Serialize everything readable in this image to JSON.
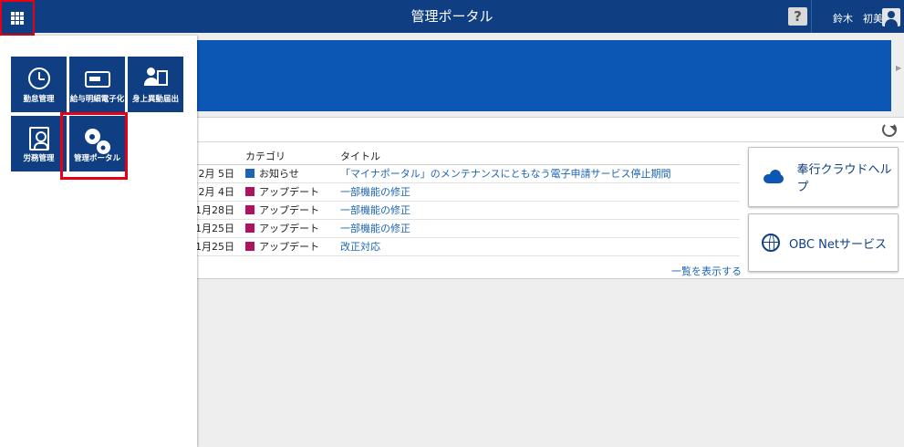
{
  "header": {
    "title": "管理ポータル",
    "help_label": "?",
    "user_name": "鈴木　初美"
  },
  "launcher": {
    "tiles": [
      {
        "label": "勤怠管理",
        "icon": "clock-icon"
      },
      {
        "label": "給与明細電子化",
        "icon": "payslip-card-icon"
      },
      {
        "label": "身上異動届出",
        "icon": "person-document-icon"
      },
      {
        "label": "労務管理",
        "icon": "person-file-icon"
      },
      {
        "label": "管理ポータル",
        "icon": "gears-icon",
        "selected": true
      }
    ]
  },
  "news": {
    "columns": {
      "date": "",
      "category": "カテゴリ",
      "title": "タイトル"
    },
    "rows": [
      {
        "date": "2月 5日",
        "category": "お知らせ",
        "category_color": "#1d64b4",
        "title": "「マイナポータル」のメンテナンスにともなう電子申請サービス停止期間"
      },
      {
        "date": "2月 4日",
        "category": "アップデート",
        "category_color": "#b0125f",
        "title": "一部機能の修正"
      },
      {
        "date": "1月28日",
        "category": "アップデート",
        "category_color": "#b0125f",
        "title": "一部機能の修正"
      },
      {
        "date": "1月25日",
        "category": "アップデート",
        "category_color": "#b0125f",
        "title": "一部機能の修正"
      },
      {
        "date": "1月25日",
        "category": "アップデート",
        "category_color": "#b0125f",
        "title": "改正対応"
      }
    ],
    "view_all": "一覧を表示する"
  },
  "side_buttons": {
    "help": "奉行クラウドヘルプ",
    "net": "OBC Netサービス"
  },
  "colors": {
    "brand_navy": "#0f3f82",
    "banner_blue": "#0b57b3",
    "highlight_red": "#e60012",
    "link_blue": "#1d64b4"
  }
}
